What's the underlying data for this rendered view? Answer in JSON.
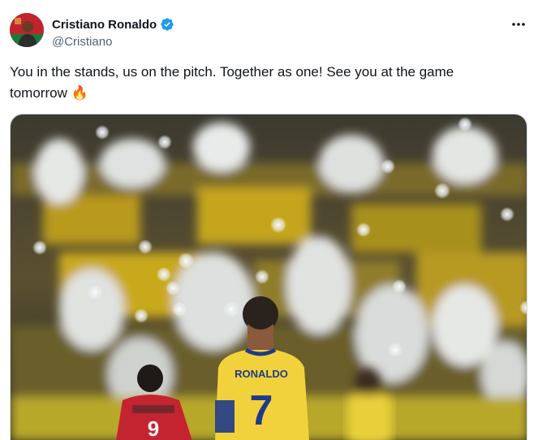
{
  "author": {
    "display_name": "Cristiano Ronaldo",
    "handle": "@Cristiano",
    "verified_icon": "verified-badge-icon",
    "avatar_icon": "avatar"
  },
  "header": {
    "more_icon": "more-options-icon"
  },
  "tweet": {
    "text_line1": "You in the stands, us on the pitch. Together as one! See you at the game",
    "text_line2": "tomorrow",
    "emoji": "🔥"
  },
  "media": {
    "jersey_name": "RONALDO",
    "jersey_number": "7",
    "opponent_number": "9"
  },
  "colors": {
    "verified": "#1d9bf0",
    "text": "#0f1419",
    "secondary": "#536471",
    "jersey_yellow": "#f2d23c",
    "jersey_blue": "#1f3a8a"
  }
}
